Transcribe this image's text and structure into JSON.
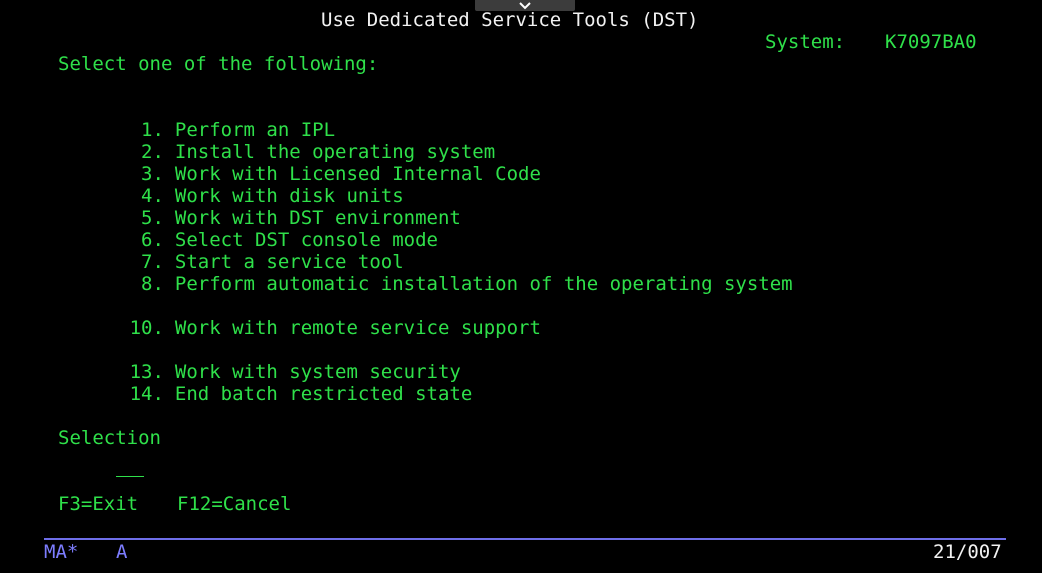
{
  "screen": {
    "title": "Use Dedicated Service Tools (DST)",
    "system_label": "System:",
    "system_name": "K7097BA0",
    "instruction": "Select one of the following:"
  },
  "menu": {
    "options": [
      {
        "number": "1.",
        "label": "Perform an IPL"
      },
      {
        "number": "2.",
        "label": "Install the operating system"
      },
      {
        "number": "3.",
        "label": "Work with Licensed Internal Code"
      },
      {
        "number": "4.",
        "label": "Work with disk units"
      },
      {
        "number": "5.",
        "label": "Work with DST environment"
      },
      {
        "number": "6.",
        "label": "Select DST console mode"
      },
      {
        "number": "7.",
        "label": "Start a service tool"
      },
      {
        "number": "8.",
        "label": "Perform automatic installation of the operating system"
      },
      {
        "number": "10.",
        "label": "Work with remote service support"
      },
      {
        "number": "13.",
        "label": "Work with system security"
      },
      {
        "number": "14.",
        "label": "End batch restricted state"
      }
    ]
  },
  "selection": {
    "label": "Selection",
    "value": ""
  },
  "function_keys": {
    "exit": "F3=Exit",
    "cancel": "F12=Cancel"
  },
  "status_bar": {
    "mode": "MA*",
    "session": "A",
    "cursor_position": "21/007"
  },
  "icons": {
    "collapse": "chevron-down-icon"
  },
  "colors": {
    "background": "#000000",
    "title": "#f2f2f2",
    "text": "#2fe04a",
    "status": "#7d7dff",
    "toolbar_tab": "#3c3c3c"
  }
}
